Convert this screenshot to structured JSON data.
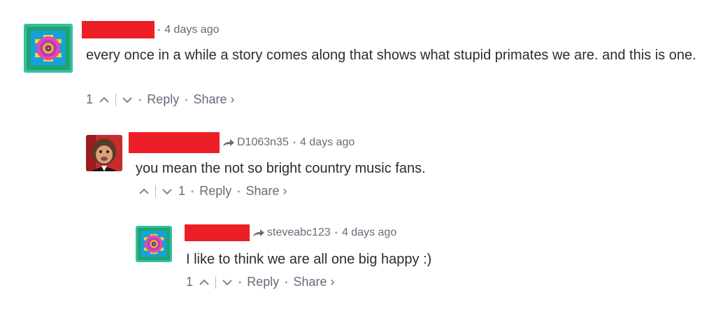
{
  "comments": [
    {
      "timestamp": "4 days ago",
      "text": "every once in a while a story comes along that shows what stupid primates we are. and this is one.",
      "upvotes": "1",
      "downvotes": "",
      "reply_label": "Reply",
      "share_label": "Share ›",
      "avatar_icon": "mandala-icon"
    },
    {
      "reply_to": "D1063n35",
      "timestamp": "4 days ago",
      "text": "you mean the not so bright country music fans.",
      "upvotes": "",
      "downvotes": "1",
      "reply_label": "Reply",
      "share_label": "Share ›",
      "avatar_icon": "monkey-face-icon"
    },
    {
      "reply_to": "steveabc123",
      "timestamp": "4 days ago",
      "text": "I like to think we are all one big happy :)",
      "upvotes": "1",
      "downvotes": "",
      "reply_label": "Reply",
      "share_label": "Share ›",
      "avatar_icon": "mandala-icon"
    }
  ],
  "colors": {
    "redaction": "#ec1f26",
    "meta": "#656c7a",
    "text": "#2a2e2e"
  }
}
